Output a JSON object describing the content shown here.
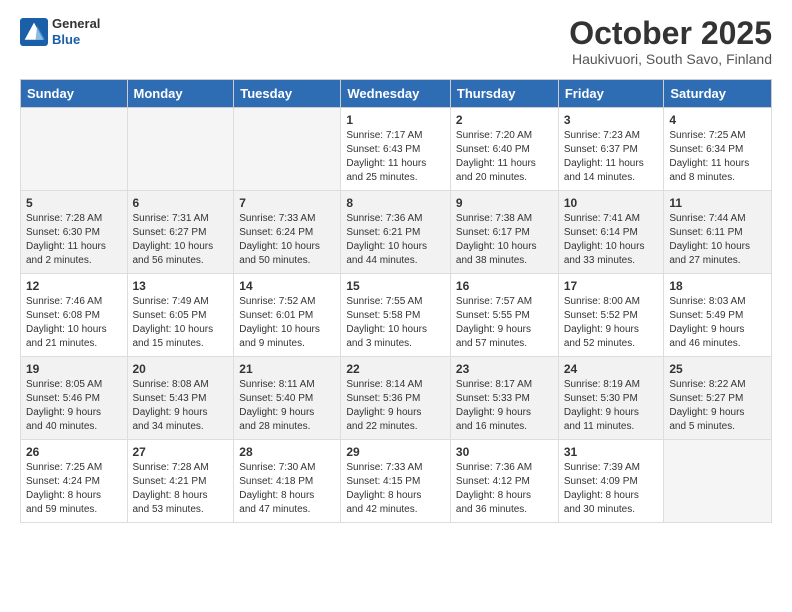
{
  "logo": {
    "general": "General",
    "blue": "Blue"
  },
  "title": "October 2025",
  "subtitle": "Haukivuori, South Savo, Finland",
  "headers": [
    "Sunday",
    "Monday",
    "Tuesday",
    "Wednesday",
    "Thursday",
    "Friday",
    "Saturday"
  ],
  "weeks": [
    [
      {
        "day": "",
        "info": ""
      },
      {
        "day": "",
        "info": ""
      },
      {
        "day": "",
        "info": ""
      },
      {
        "day": "1",
        "info": "Sunrise: 7:17 AM\nSunset: 6:43 PM\nDaylight: 11 hours\nand 25 minutes."
      },
      {
        "day": "2",
        "info": "Sunrise: 7:20 AM\nSunset: 6:40 PM\nDaylight: 11 hours\nand 20 minutes."
      },
      {
        "day": "3",
        "info": "Sunrise: 7:23 AM\nSunset: 6:37 PM\nDaylight: 11 hours\nand 14 minutes."
      },
      {
        "day": "4",
        "info": "Sunrise: 7:25 AM\nSunset: 6:34 PM\nDaylight: 11 hours\nand 8 minutes."
      }
    ],
    [
      {
        "day": "5",
        "info": "Sunrise: 7:28 AM\nSunset: 6:30 PM\nDaylight: 11 hours\nand 2 minutes."
      },
      {
        "day": "6",
        "info": "Sunrise: 7:31 AM\nSunset: 6:27 PM\nDaylight: 10 hours\nand 56 minutes."
      },
      {
        "day": "7",
        "info": "Sunrise: 7:33 AM\nSunset: 6:24 PM\nDaylight: 10 hours\nand 50 minutes."
      },
      {
        "day": "8",
        "info": "Sunrise: 7:36 AM\nSunset: 6:21 PM\nDaylight: 10 hours\nand 44 minutes."
      },
      {
        "day": "9",
        "info": "Sunrise: 7:38 AM\nSunset: 6:17 PM\nDaylight: 10 hours\nand 38 minutes."
      },
      {
        "day": "10",
        "info": "Sunrise: 7:41 AM\nSunset: 6:14 PM\nDaylight: 10 hours\nand 33 minutes."
      },
      {
        "day": "11",
        "info": "Sunrise: 7:44 AM\nSunset: 6:11 PM\nDaylight: 10 hours\nand 27 minutes."
      }
    ],
    [
      {
        "day": "12",
        "info": "Sunrise: 7:46 AM\nSunset: 6:08 PM\nDaylight: 10 hours\nand 21 minutes."
      },
      {
        "day": "13",
        "info": "Sunrise: 7:49 AM\nSunset: 6:05 PM\nDaylight: 10 hours\nand 15 minutes."
      },
      {
        "day": "14",
        "info": "Sunrise: 7:52 AM\nSunset: 6:01 PM\nDaylight: 10 hours\nand 9 minutes."
      },
      {
        "day": "15",
        "info": "Sunrise: 7:55 AM\nSunset: 5:58 PM\nDaylight: 10 hours\nand 3 minutes."
      },
      {
        "day": "16",
        "info": "Sunrise: 7:57 AM\nSunset: 5:55 PM\nDaylight: 9 hours\nand 57 minutes."
      },
      {
        "day": "17",
        "info": "Sunrise: 8:00 AM\nSunset: 5:52 PM\nDaylight: 9 hours\nand 52 minutes."
      },
      {
        "day": "18",
        "info": "Sunrise: 8:03 AM\nSunset: 5:49 PM\nDaylight: 9 hours\nand 46 minutes."
      }
    ],
    [
      {
        "day": "19",
        "info": "Sunrise: 8:05 AM\nSunset: 5:46 PM\nDaylight: 9 hours\nand 40 minutes."
      },
      {
        "day": "20",
        "info": "Sunrise: 8:08 AM\nSunset: 5:43 PM\nDaylight: 9 hours\nand 34 minutes."
      },
      {
        "day": "21",
        "info": "Sunrise: 8:11 AM\nSunset: 5:40 PM\nDaylight: 9 hours\nand 28 minutes."
      },
      {
        "day": "22",
        "info": "Sunrise: 8:14 AM\nSunset: 5:36 PM\nDaylight: 9 hours\nand 22 minutes."
      },
      {
        "day": "23",
        "info": "Sunrise: 8:17 AM\nSunset: 5:33 PM\nDaylight: 9 hours\nand 16 minutes."
      },
      {
        "day": "24",
        "info": "Sunrise: 8:19 AM\nSunset: 5:30 PM\nDaylight: 9 hours\nand 11 minutes."
      },
      {
        "day": "25",
        "info": "Sunrise: 8:22 AM\nSunset: 5:27 PM\nDaylight: 9 hours\nand 5 minutes."
      }
    ],
    [
      {
        "day": "26",
        "info": "Sunrise: 7:25 AM\nSunset: 4:24 PM\nDaylight: 8 hours\nand 59 minutes."
      },
      {
        "day": "27",
        "info": "Sunrise: 7:28 AM\nSunset: 4:21 PM\nDaylight: 8 hours\nand 53 minutes."
      },
      {
        "day": "28",
        "info": "Sunrise: 7:30 AM\nSunset: 4:18 PM\nDaylight: 8 hours\nand 47 minutes."
      },
      {
        "day": "29",
        "info": "Sunrise: 7:33 AM\nSunset: 4:15 PM\nDaylight: 8 hours\nand 42 minutes."
      },
      {
        "day": "30",
        "info": "Sunrise: 7:36 AM\nSunset: 4:12 PM\nDaylight: 8 hours\nand 36 minutes."
      },
      {
        "day": "31",
        "info": "Sunrise: 7:39 AM\nSunset: 4:09 PM\nDaylight: 8 hours\nand 30 minutes."
      },
      {
        "day": "",
        "info": ""
      }
    ]
  ]
}
